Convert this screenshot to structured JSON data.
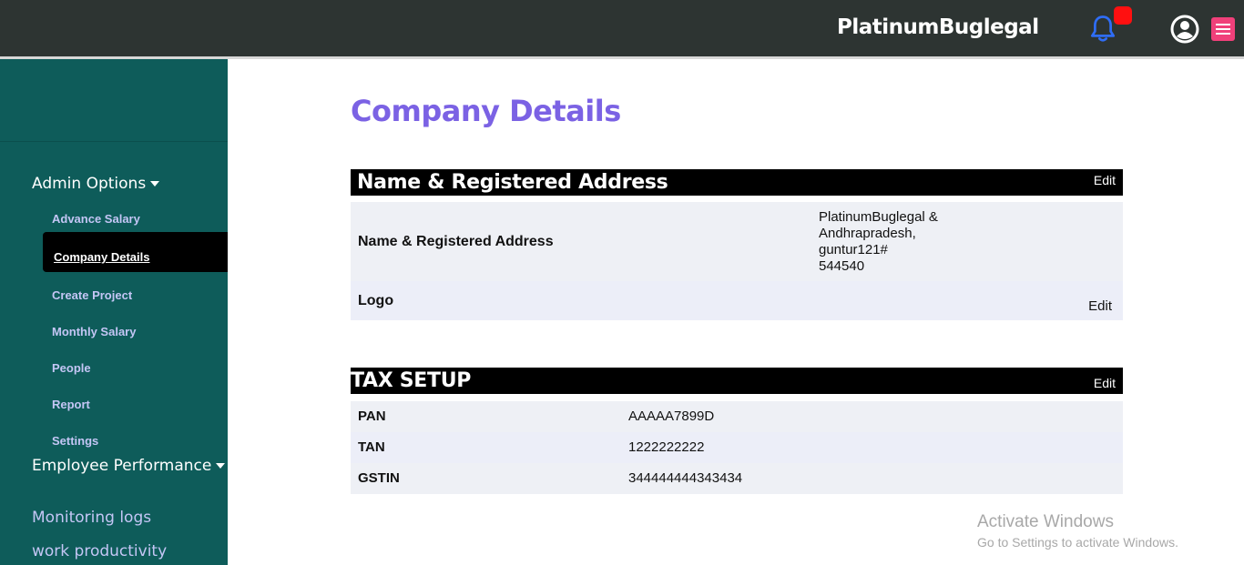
{
  "header": {
    "brand": "PlatinumBuglegal",
    "notification_color": "#ff1010",
    "icons": [
      "bell-icon",
      "user-circle-icon",
      "hamburger-menu-icon"
    ]
  },
  "sidebar": {
    "admin_heading": "Admin Options",
    "items": [
      {
        "label": "Advance Salary"
      },
      {
        "label": "Company Details",
        "active": true
      },
      {
        "label": "Create Project"
      },
      {
        "label": "Monthly Salary"
      },
      {
        "label": "People"
      },
      {
        "label": "Report"
      },
      {
        "label": "Settings"
      }
    ],
    "employee_heading": "Employee Performance",
    "links": [
      {
        "label": "Monitoring logs"
      },
      {
        "label": "work productivity"
      }
    ],
    "background_color": "#0e5c5a"
  },
  "main": {
    "title": "Company Details",
    "title_color": "#7b62e4",
    "address_card": {
      "title": "Name & Registered Address",
      "edit_label": "Edit",
      "rows": [
        {
          "label": "Name & Registered Address",
          "value_lines": [
            "PlatinumBuglegal &",
            "Andhrapradesh,",
            "guntur121#",
            "544540"
          ]
        },
        {
          "label": "Logo",
          "edit_label": "Edit"
        }
      ]
    },
    "tax_card": {
      "title": "TAX SETUP",
      "edit_label": "Edit",
      "rows": [
        {
          "label": "PAN",
          "value": "AAAAA7899D"
        },
        {
          "label": "TAN",
          "value": "1222222222"
        },
        {
          "label": "GSTIN",
          "value": "344444444343434"
        }
      ]
    }
  },
  "watermark": {
    "line1": "Activate Windows",
    "line2": "Go to Settings to activate Windows."
  }
}
